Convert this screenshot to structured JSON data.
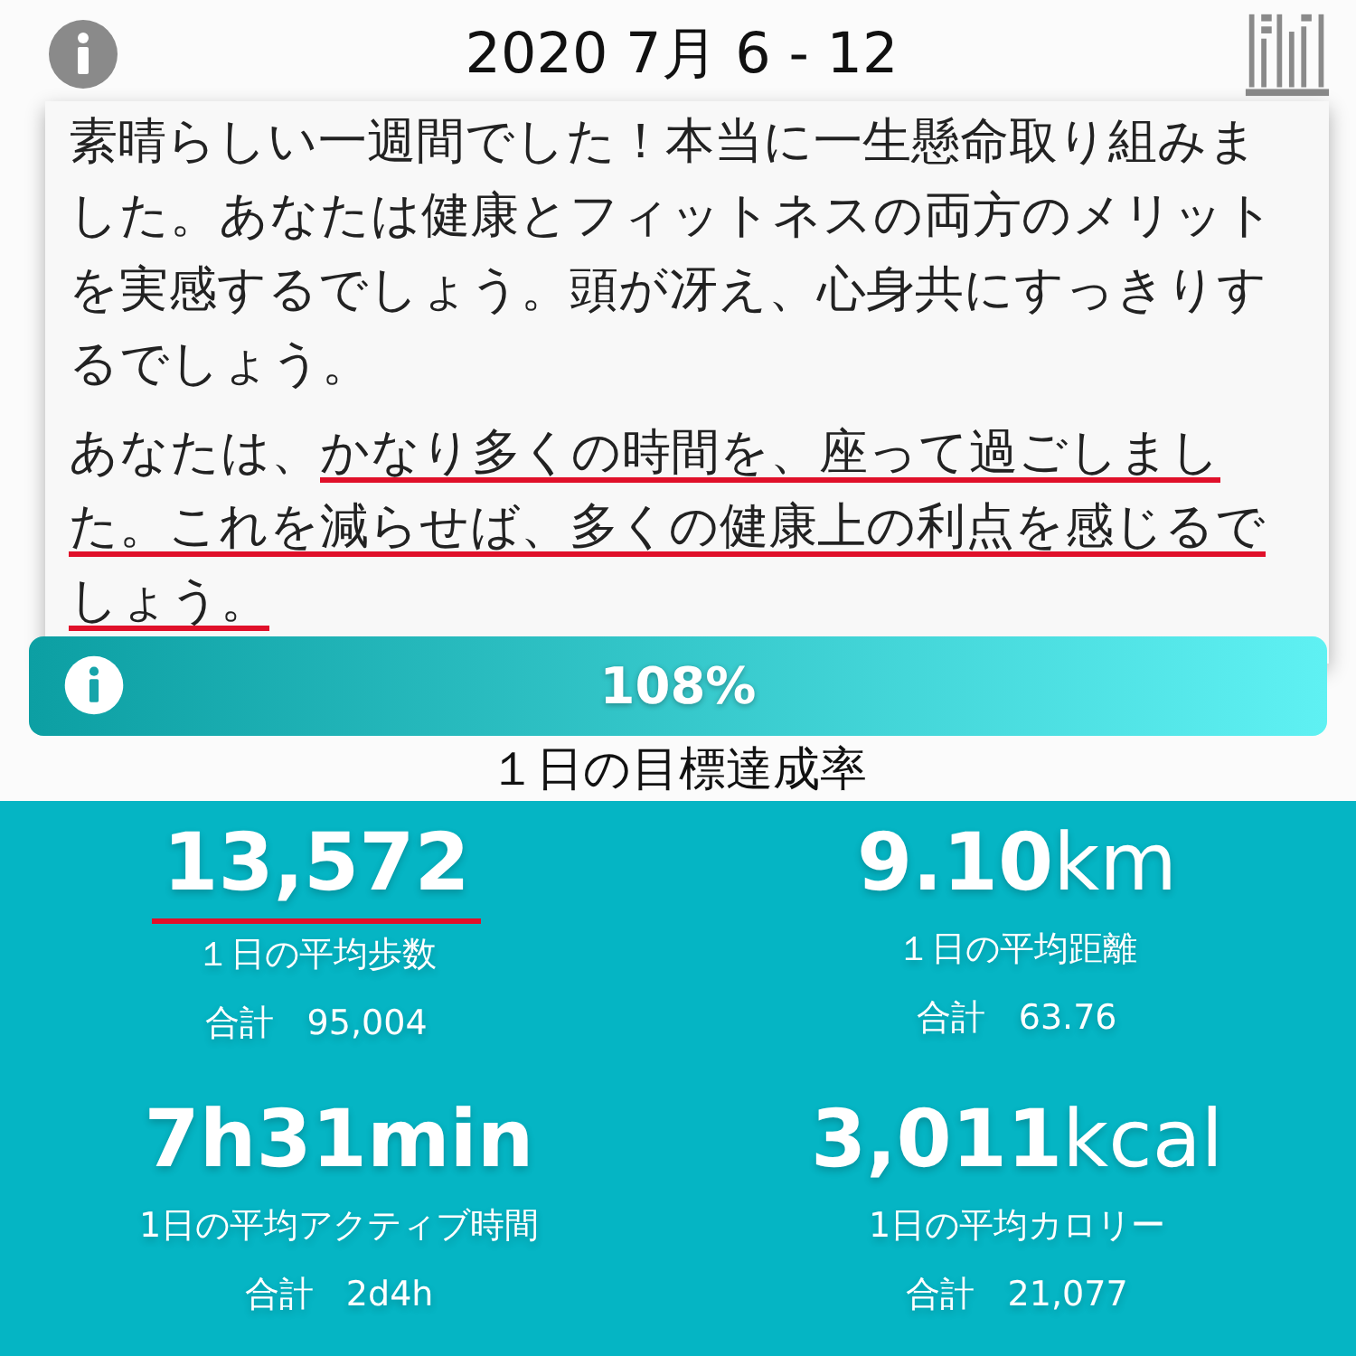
{
  "header": {
    "title": "2020 7月 6 - 12"
  },
  "popup": {
    "paragraphs": [
      [
        {
          "text": "素晴らしい一週間でした！本当に一生懸命取り組みました。あなたは健康とフィットネスの両方のメリットを実感するでしょう。頭が冴え、心身共にすっきりするでしょう。",
          "underlined": false
        }
      ],
      [
        {
          "text": "あなたは、",
          "underlined": false
        },
        {
          "text": "かなり多くの時間を、座って過ごしました。これを減らせば、多くの健康上の利点を感じるでしょう。",
          "underlined": true
        }
      ]
    ]
  },
  "goal": {
    "level": 1.0,
    "reading": "108%",
    "label": "１日の目標達成率"
  },
  "stats": [
    {
      "value": "13,572",
      "label": "１日の平均歩数",
      "total_label": "合計",
      "total": "95,004",
      "underlined": true
    },
    {
      "value": "9.10",
      "unit": "km",
      "label": "１日の平均距離",
      "total_label": "合計",
      "total": "63.76",
      "underlined": false
    },
    {
      "value": "7h31min",
      "label": "1日の平均アクティブ時間",
      "total_label": "合計",
      "total": "2d4h",
      "underlined": false
    },
    {
      "value": "3,011",
      "unit": "kcal",
      "label": "1日の平均カロリー",
      "total_label": "合計",
      "total": "21,077",
      "underlined": false
    }
  ]
}
